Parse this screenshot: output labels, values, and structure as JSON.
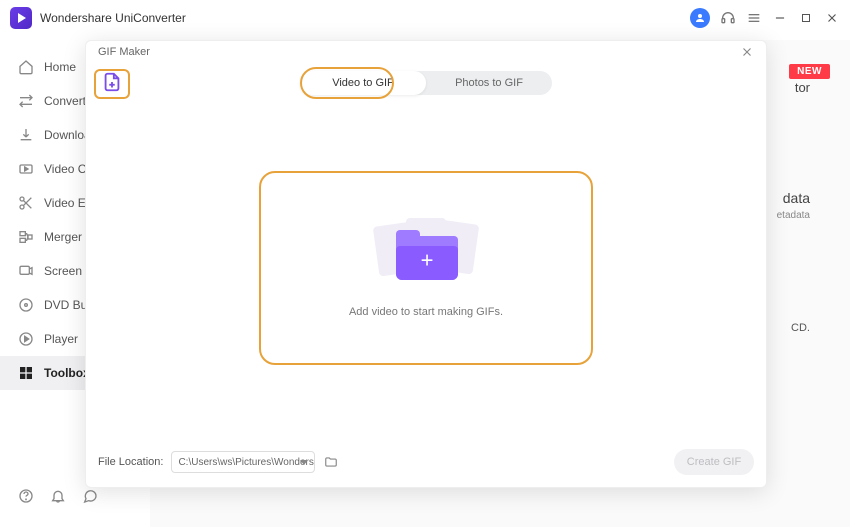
{
  "app": {
    "title": "Wondershare UniConverter"
  },
  "titlebar": {
    "avatar_icon": "user",
    "icons": [
      "headset",
      "menu"
    ]
  },
  "sidebar": {
    "items": [
      {
        "label": "Home",
        "icon": "home"
      },
      {
        "label": "Converter",
        "icon": "convert"
      },
      {
        "label": "Downloader",
        "icon": "download"
      },
      {
        "label": "Video Compressor",
        "icon": "compress"
      },
      {
        "label": "Video Editor",
        "icon": "scissors"
      },
      {
        "label": "Merger",
        "icon": "merge"
      },
      {
        "label": "Screen Recorder",
        "icon": "record"
      },
      {
        "label": "DVD Burner",
        "icon": "disc"
      },
      {
        "label": "Player",
        "icon": "play"
      },
      {
        "label": "Toolbox",
        "icon": "toolbox",
        "active": true
      }
    ],
    "bottom_icons": [
      "help",
      "bell",
      "chat"
    ]
  },
  "content_peek": {
    "new_badge": "NEW",
    "t1": "tor",
    "t2": "data",
    "t3": "etadata",
    "t4": "CD."
  },
  "modal": {
    "title": "GIF Maker",
    "tabs": {
      "video": "Video to GIF",
      "photos": "Photos to GIF"
    },
    "drop_text": "Add video to start making GIFs.",
    "footer": {
      "label": "File Location:",
      "path": "C:\\Users\\ws\\Pictures\\Wonders",
      "create_label": "Create GIF"
    }
  }
}
